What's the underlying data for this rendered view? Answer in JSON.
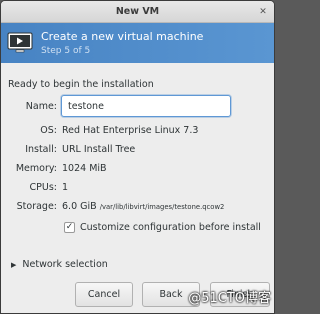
{
  "window": {
    "title": "New VM",
    "close_glyph": "✕"
  },
  "banner": {
    "title": "Create a new virtual machine",
    "step": "Step 5 of 5",
    "icon": "monitor-play-icon",
    "bg_color": "#4a89c9"
  },
  "main": {
    "section_label": "Ready to begin the installation",
    "fields": {
      "name": {
        "label": "Name:",
        "value": "testone"
      },
      "os": {
        "label": "OS:",
        "value": "Red Hat Enterprise Linux 7.3"
      },
      "install": {
        "label": "Install:",
        "value": "URL Install Tree"
      },
      "memory": {
        "label": "Memory:",
        "value": "1024 MiB"
      },
      "cpus": {
        "label": "CPUs:",
        "value": "1"
      },
      "storage": {
        "label": "Storage:",
        "size": "6.0 GiB",
        "path": "/var/lib/libvirt/images/testone.qcow2"
      }
    },
    "customize": {
      "label": "Customize configuration before install",
      "checked": true,
      "glyph": "✓"
    },
    "network": {
      "label": "Network selection",
      "arrow": "▶"
    }
  },
  "buttons": {
    "cancel": "Cancel",
    "back": "Back",
    "finish": "Finish"
  },
  "watermark": "@51CTO博客"
}
